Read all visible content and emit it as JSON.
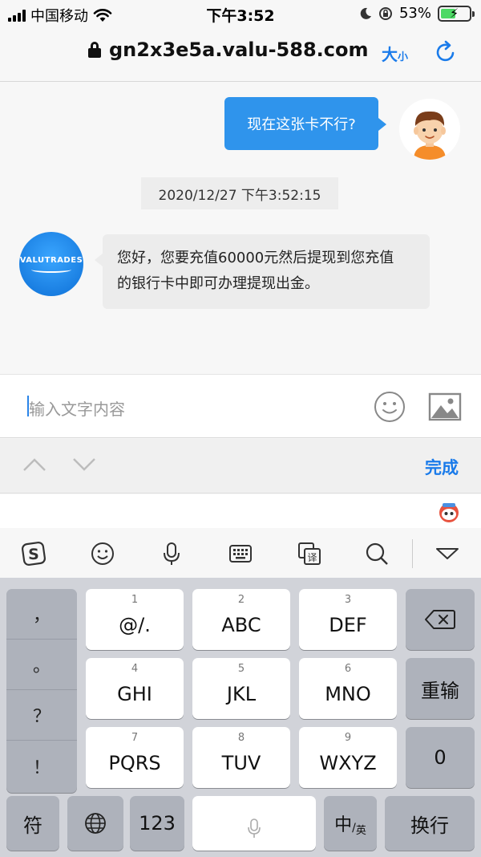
{
  "status_bar": {
    "carrier": "中国移动",
    "time": "下午3:52",
    "battery_percent": "53%",
    "battery_level": 0.53
  },
  "address_bar": {
    "url": "gn2x3e5a.valu-588.com",
    "text_size_big": "大",
    "text_size_small": "小"
  },
  "chat": {
    "outgoing_message": "现在这张卡不行?",
    "timestamp": "2020/12/27 下午3:52:15",
    "bot_logo_text": "VALUTRADES",
    "incoming_message_line1": "您好，您要充值60000元然后提现到您充值",
    "incoming_message_line2": "的银行卡中即可办理提现出金。"
  },
  "input": {
    "placeholder": "输入文字内容"
  },
  "accessory": {
    "done_label": "完成"
  },
  "keyboard": {
    "side_keys": [
      "，",
      "。",
      "？",
      "！"
    ],
    "keys": [
      {
        "num": "1",
        "label": "@/."
      },
      {
        "num": "2",
        "label": "ABC"
      },
      {
        "num": "3",
        "label": "DEF"
      },
      {
        "num": "4",
        "label": "GHI"
      },
      {
        "num": "5",
        "label": "JKL"
      },
      {
        "num": "6",
        "label": "MNO"
      },
      {
        "num": "7",
        "label": "PQRS"
      },
      {
        "num": "8",
        "label": "TUV"
      },
      {
        "num": "9",
        "label": "WXYZ"
      }
    ],
    "reenter_label": "重输",
    "zero_label": "0",
    "symbol_label": "符",
    "num_mode_label": "123",
    "lang_main": "中",
    "lang_sub": "英",
    "return_label": "换行"
  },
  "colors": {
    "accent": "#1a7bea",
    "outgoing_bubble": "#2f94ec",
    "incoming_bubble": "#ececec",
    "keyboard_bg": "#d1d3d9"
  }
}
